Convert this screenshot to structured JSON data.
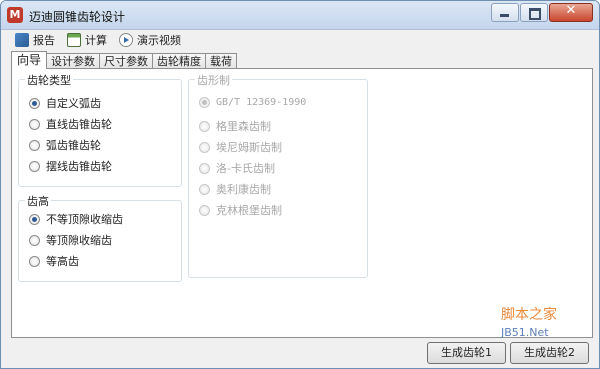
{
  "window": {
    "title": "迈迪圆锥齿轮设计",
    "icon_glyph": "M"
  },
  "toolbar": {
    "items": [
      {
        "label": "报告",
        "icon": "report-icon"
      },
      {
        "label": "计算",
        "icon": "calculator-icon"
      },
      {
        "label": "演示视频",
        "icon": "video-icon"
      }
    ]
  },
  "tabs": [
    "向导",
    "设计参数",
    "尺寸参数",
    "齿轮精度",
    "载荷"
  ],
  "active_tab": "向导",
  "gear_type": {
    "title": "齿轮类型",
    "options": [
      "自定义弧齿",
      "直线齿锥齿轮",
      "弧齿锥齿轮",
      "摆线齿锥齿轮"
    ],
    "selected": "自定义弧齿"
  },
  "tooth_height": {
    "title": "齿高",
    "options": [
      "不等顶隙收缩齿",
      "等顶隙收缩齿",
      "等高齿"
    ],
    "selected": "不等顶隙收缩齿"
  },
  "tooth_system": {
    "title": "齿形制",
    "disabled": true,
    "options": [
      "GB/T 12369-1990",
      "格里森齿制",
      "埃尼姆斯齿制",
      "洛-卡氏齿制",
      "奥利康齿制",
      "克林根堡齿制"
    ],
    "selected": "GB/T 12369-1990"
  },
  "buttons": {
    "generate1": "生成齿轮1",
    "generate2": "生成齿轮2"
  },
  "watermark": {
    "line1": "脚本之家",
    "line2": "JB51.Net"
  },
  "colors": {
    "titlebar": "#c4d6ec",
    "close": "#c9452d",
    "radio_checked": "#2f5b95",
    "disabled_text": "#a8a8a8"
  }
}
